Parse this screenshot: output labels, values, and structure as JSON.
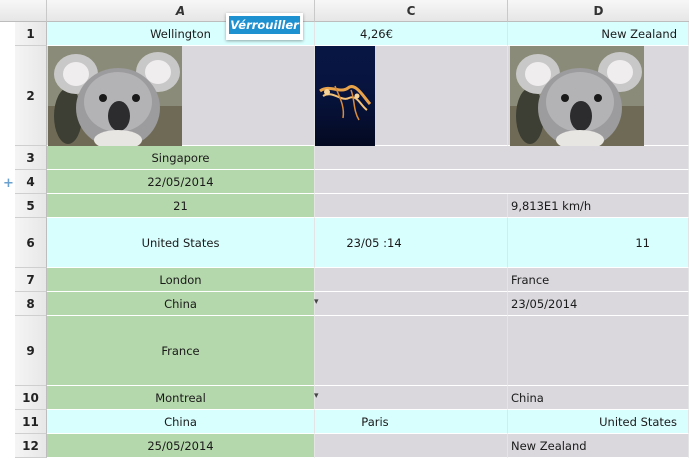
{
  "lock_button": {
    "label": "Vérrouiller"
  },
  "columns": [
    "",
    "A",
    "C",
    "D"
  ],
  "rows": [
    {
      "num": "1",
      "cells": [
        "Wellington",
        "4,26€",
        "New Zealand"
      ]
    },
    {
      "num": "2",
      "cells": [
        "",
        "",
        ""
      ]
    },
    {
      "num": "3",
      "cells": [
        "Singapore",
        "",
        ""
      ]
    },
    {
      "num": "4",
      "cells": [
        "22/05/2014",
        "",
        ""
      ]
    },
    {
      "num": "5",
      "cells": [
        "21",
        "",
        "9,813E1 km/h"
      ]
    },
    {
      "num": "6",
      "cells": [
        "United States",
        "23/05 :14",
        "11"
      ]
    },
    {
      "num": "7",
      "cells": [
        "London",
        "",
        "France"
      ]
    },
    {
      "num": "8",
      "cells": [
        "China",
        "",
        "23/05/2014"
      ]
    },
    {
      "num": "9",
      "cells": [
        "France",
        "",
        ""
      ]
    },
    {
      "num": "10",
      "cells": [
        "Montreal",
        "",
        "China"
      ]
    },
    {
      "num": "11",
      "cells": [
        "China",
        "Paris",
        "United States"
      ]
    },
    {
      "num": "12",
      "cells": [
        "25/05/2014",
        "",
        "New Zealand"
      ]
    }
  ],
  "images": {
    "koala": "koala-photo",
    "jellyfish": "jellyfish-photo"
  },
  "colors": {
    "cyan": "#d9fefe",
    "green": "#b4d7ab",
    "gray": "#dad8dd",
    "accent": "#1e91d1"
  }
}
